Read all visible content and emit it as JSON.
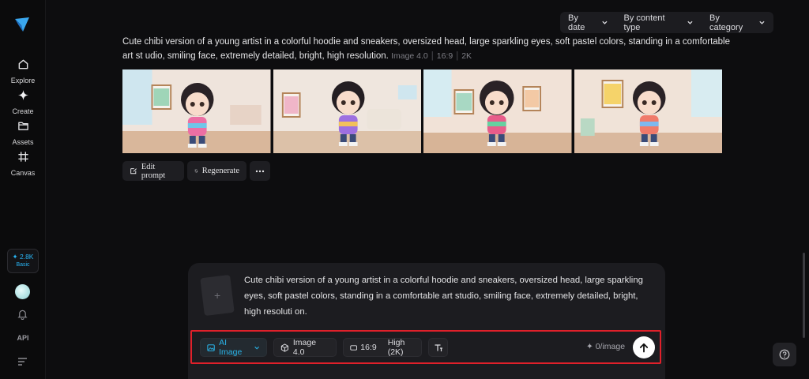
{
  "sidebar": {
    "items": [
      {
        "label": "Explore",
        "icon": "home-icon"
      },
      {
        "label": "Create",
        "icon": "sparkle-icon"
      },
      {
        "label": "Assets",
        "icon": "folder-icon"
      },
      {
        "label": "Canvas",
        "icon": "canvas-icon"
      }
    ],
    "credits": {
      "count": "2.8K",
      "plan": "Basic"
    },
    "api_label": "API"
  },
  "filters": {
    "date": "By date",
    "content_type": "By content type",
    "category": "By category"
  },
  "generation": {
    "prompt": "Cute chibi version of a young artist in a colorful hoodie and sneakers, oversized head, large sparkling eyes, soft pastel colors, standing in a comfortable art st udio, smiling face, extremely detailed, bright, high resolution.",
    "model": "Image 4.0",
    "ratio": "16:9",
    "resolution": "2K",
    "actions": {
      "edit": "Edit prompt",
      "regenerate": "Regenerate"
    }
  },
  "composer": {
    "text": "Cute chibi version of a young artist in a colorful hoodie and sneakers, oversized head, large sparkling eyes, soft pastel colors, standing in a comfortable art studio, smiling face, extremely detailed, bright, high resoluti on.",
    "mode": "AI Image",
    "model": "Image 4.0",
    "ratio": "16:9",
    "quality": "High (2K)",
    "cost": "0/image"
  },
  "colors": {
    "accent": "#2ab2e6",
    "highlight_border": "#e0202a",
    "background": "#0d0d0f"
  }
}
